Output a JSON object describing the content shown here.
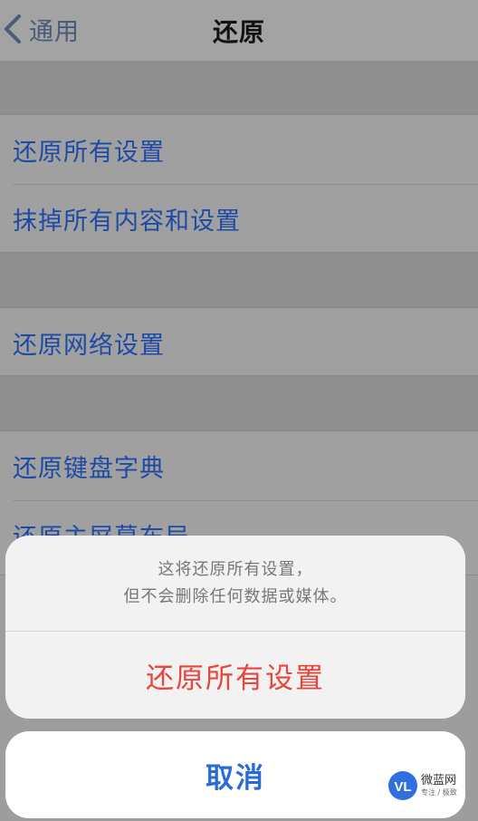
{
  "navbar": {
    "back_label": "通用",
    "title": "还原"
  },
  "settings": {
    "group1": [
      "还原所有设置",
      "抹掉所有内容和设置"
    ],
    "group2": [
      "还原网络设置"
    ],
    "group3": [
      "还原键盘字典",
      "还原主屏幕布局"
    ]
  },
  "action_sheet": {
    "message_line1": "这将还原所有设置，",
    "message_line2": "但不会删除任何数据或媒体。",
    "destructive_label": "还原所有设置",
    "cancel_label": "取消"
  },
  "watermark": {
    "name": "微蓝网",
    "sub": "专注 / 极致",
    "logo_text": "VL"
  },
  "colors": {
    "link_blue": "#1e4aa6",
    "destructive_red": "#e8453c",
    "cancel_blue": "#2a6bd6"
  }
}
